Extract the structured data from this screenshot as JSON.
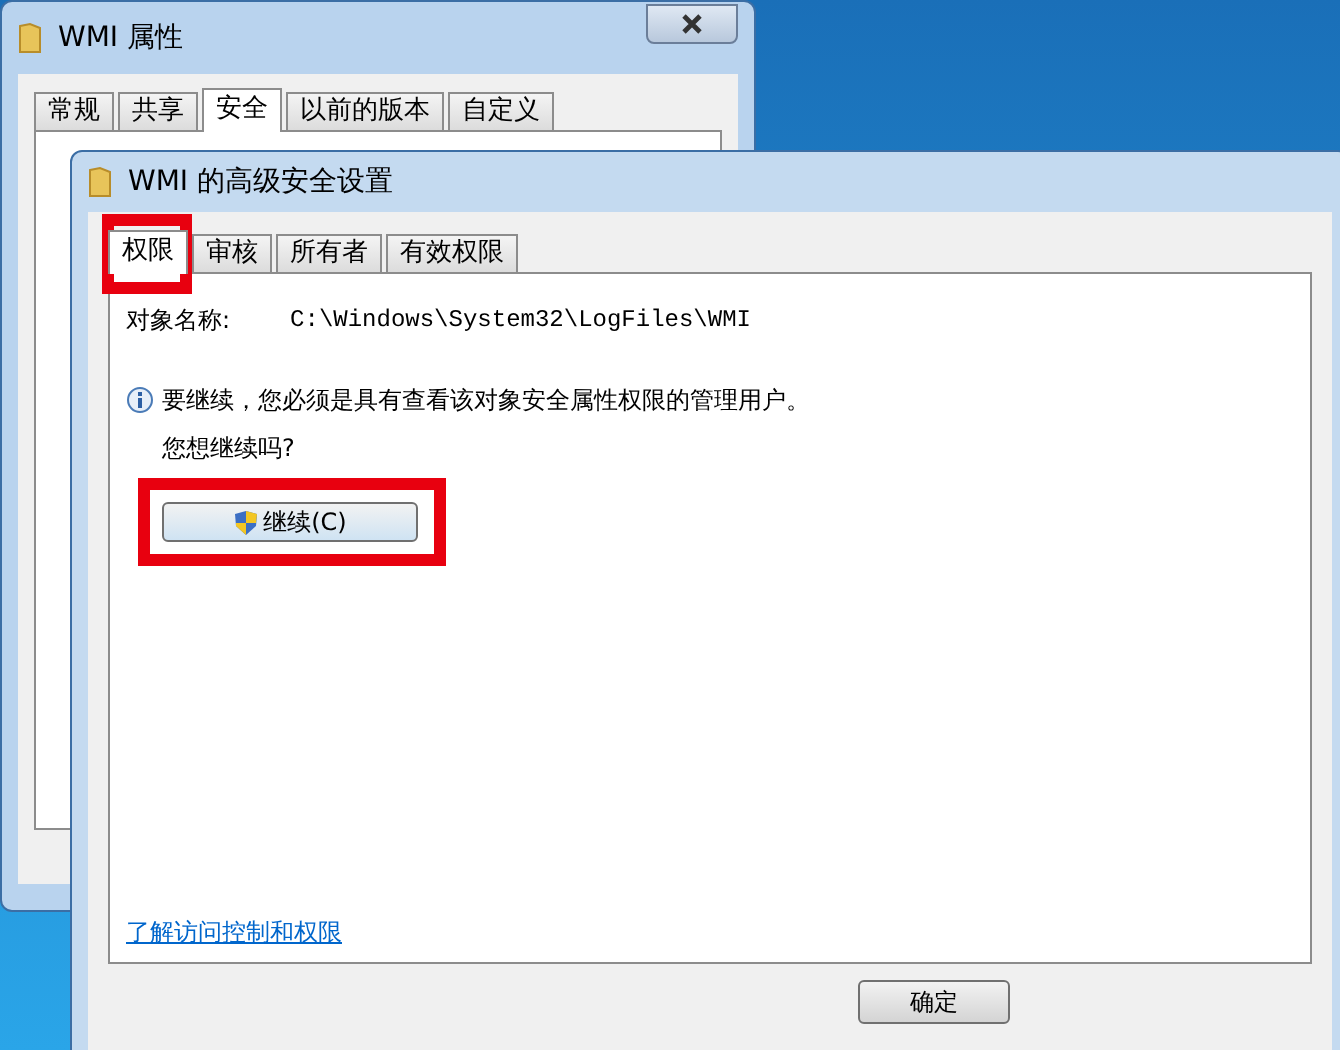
{
  "back_window": {
    "title": "WMI 属性",
    "tabs": [
      {
        "label": "常规",
        "selected": false
      },
      {
        "label": "共享",
        "selected": false
      },
      {
        "label": "安全",
        "selected": true
      },
      {
        "label": "以前的版本",
        "selected": false
      },
      {
        "label": "自定义",
        "selected": false
      }
    ]
  },
  "window": {
    "title": "WMI 的高级安全设置",
    "tabs": [
      {
        "label": "权限",
        "selected": true
      },
      {
        "label": "审核",
        "selected": false
      },
      {
        "label": "所有者",
        "selected": false
      },
      {
        "label": "有效权限",
        "selected": false
      }
    ],
    "object_label": "对象名称:",
    "object_path": "C:\\Windows\\System32\\LogFiles\\WMI",
    "info": "要继续，您必须是具有查看该对象安全属性权限的管理用户。",
    "question": "您想继续吗?",
    "continue_button": "继续(C)",
    "link": "了解访问控制和权限",
    "ok_button": "确定"
  }
}
